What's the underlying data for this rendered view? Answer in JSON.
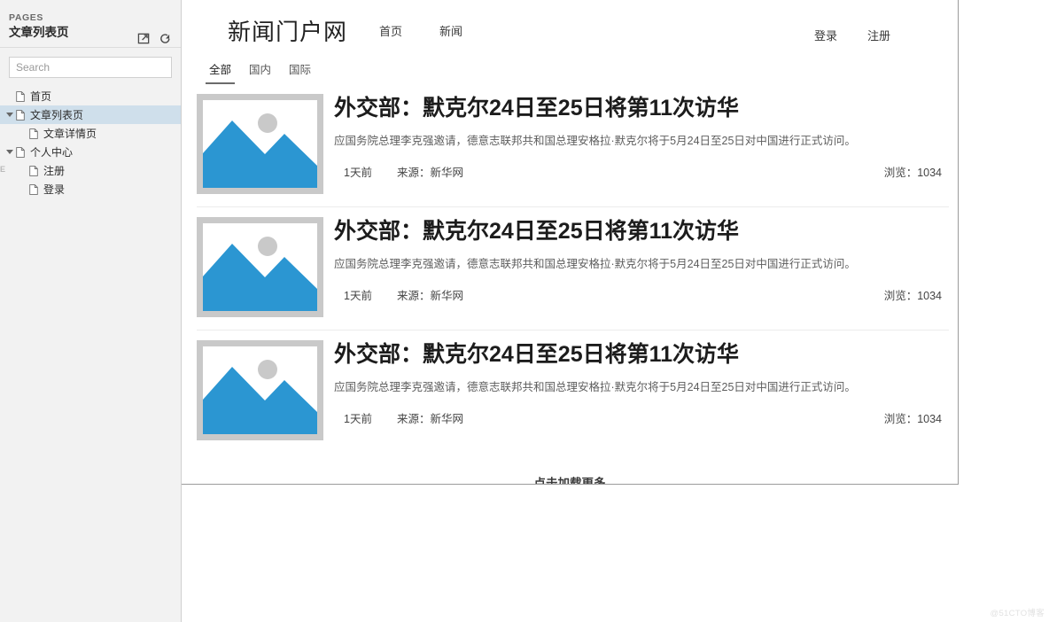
{
  "sidebar": {
    "section_label": "PAGES",
    "page_title": "文章列表页",
    "icons": [
      {
        "name": "open-in-new-window-icon",
        "title": "在新窗口打开"
      },
      {
        "name": "refresh-icon",
        "title": "刷新"
      }
    ],
    "search": {
      "placeholder": "Search",
      "value": ""
    },
    "edge_letter": "E",
    "tree": [
      {
        "label": "首页",
        "depth": 1,
        "expandable": false,
        "selected": false
      },
      {
        "label": "文章列表页",
        "depth": 1,
        "expandable": true,
        "selected": true
      },
      {
        "label": "文章详情页",
        "depth": 2,
        "expandable": false,
        "selected": false
      },
      {
        "label": "个人中心",
        "depth": 1,
        "expandable": true,
        "selected": false
      },
      {
        "label": "注册",
        "depth": 2,
        "expandable": false,
        "selected": false
      },
      {
        "label": "登录",
        "depth": 2,
        "expandable": false,
        "selected": false
      }
    ]
  },
  "canvas": {
    "header": {
      "logo": "新闻门户网",
      "nav": [
        {
          "label": "首页"
        },
        {
          "label": "新闻"
        }
      ],
      "auth": [
        {
          "label": "登录"
        },
        {
          "label": "注册"
        }
      ]
    },
    "tabs": [
      {
        "label": "全部",
        "active": true
      },
      {
        "label": "国内",
        "active": false
      },
      {
        "label": "国际",
        "active": false
      }
    ],
    "articles": [
      {
        "title": "外交部：默克尔24日至25日将第11次访华",
        "summary": "应国务院总理李克强邀请，德意志联邦共和国总理安格拉·默克尔将于5月24日至25日对中国进行正式访问。",
        "time": "1天前",
        "source": "来源：新华网",
        "views": "浏览：1034",
        "thumb_alt": "image-placeholder"
      },
      {
        "title": "外交部：默克尔24日至25日将第11次访华",
        "summary": "应国务院总理李克强邀请，德意志联邦共和国总理安格拉·默克尔将于5月24日至25日对中国进行正式访问。",
        "time": "1天前",
        "source": "来源：新华网",
        "views": "浏览：1034",
        "thumb_alt": "image-placeholder"
      },
      {
        "title": "外交部：默克尔24日至25日将第11次访华",
        "summary": "应国务院总理李克强邀请，德意志联邦共和国总理安格拉·默克尔将于5月24日至25日对中国进行正式访问。",
        "time": "1天前",
        "source": "来源：新华网",
        "views": "浏览：1034",
        "thumb_alt": "image-placeholder"
      }
    ],
    "load_more": "点击加载更多"
  },
  "watermark": "@51CTO博客",
  "colors": {
    "thumb_blue": "#2b96d2",
    "thumb_frame": "#c9c9c9",
    "thumb_circle": "#c9c9c9",
    "sidebar_bg": "#f2f2f2",
    "tree_selected": "#cfdfeb"
  }
}
